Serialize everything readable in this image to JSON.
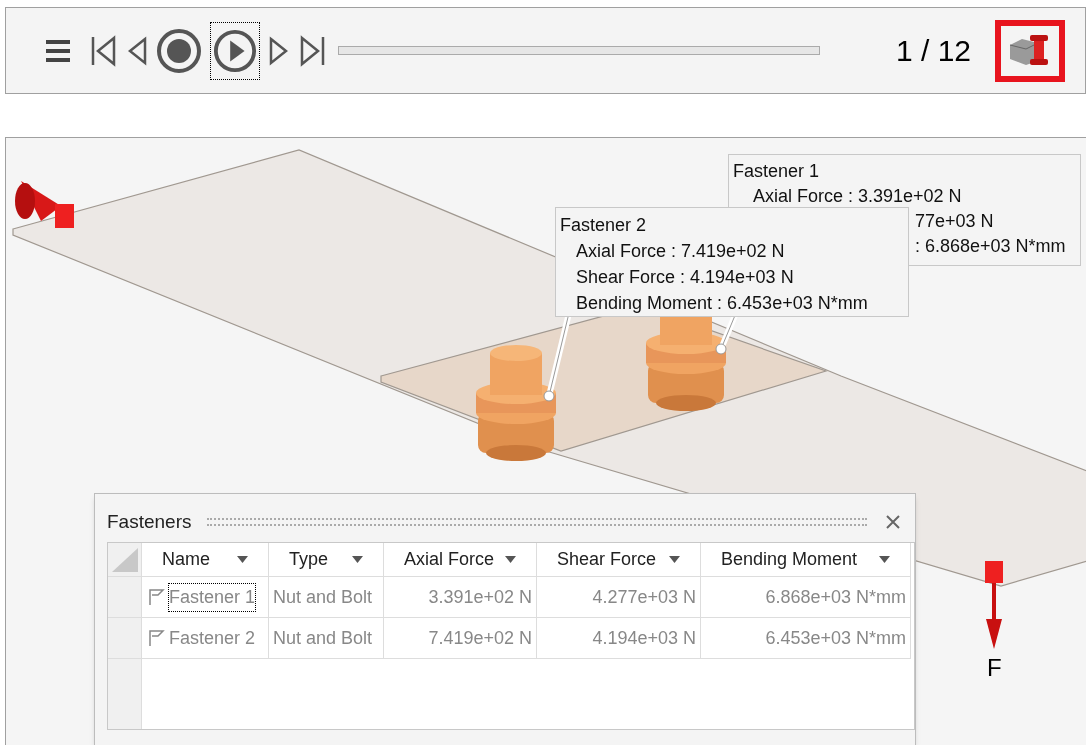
{
  "toolbar": {
    "frame_counter": "1 / 12",
    "play_focused": true,
    "fastener_button": {
      "selected": true
    }
  },
  "tooltips": [
    {
      "title": "Fastener 1",
      "lines": [
        "Axial Force : 3.391e+02 N",
        "77e+03 N",
        ": 6.868e+03 N*mm"
      ]
    },
    {
      "title": "Fastener 2",
      "lines": [
        "Axial Force : 7.419e+02 N",
        "Shear Force : 4.194e+03 N",
        "Bending Moment : 6.453e+03 N*mm"
      ]
    }
  ],
  "force_label": "F",
  "fasteners_panel": {
    "title": "Fasteners",
    "columns": [
      "Name",
      "Type",
      "Axial Force",
      "Shear Force",
      "Bending Moment"
    ],
    "rows": [
      {
        "name": "Fastener 1",
        "type": "Nut and Bolt",
        "axial": "3.391e+02 N",
        "shear": "4.277e+03 N",
        "bending": "6.868e+03 N*mm",
        "focused": true
      },
      {
        "name": "Fastener 2",
        "type": "Nut and Bolt",
        "axial": "7.419e+02 N",
        "shear": "4.194e+03 N",
        "bending": "6.453e+03 N*mm",
        "focused": false
      }
    ]
  }
}
